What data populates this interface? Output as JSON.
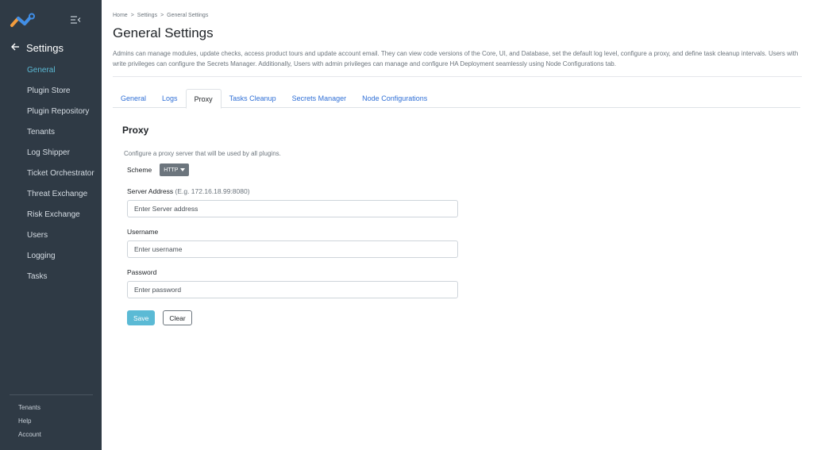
{
  "sidebar": {
    "back_label": "Settings",
    "items": [
      {
        "label": "General",
        "active": true
      },
      {
        "label": "Plugin Store",
        "active": false
      },
      {
        "label": "Plugin Repository",
        "active": false
      },
      {
        "label": "Tenants",
        "active": false
      },
      {
        "label": "Log Shipper",
        "active": false
      },
      {
        "label": "Ticket Orchestrator",
        "active": false
      },
      {
        "label": "Threat Exchange",
        "active": false
      },
      {
        "label": "Risk Exchange",
        "active": false
      },
      {
        "label": "Users",
        "active": false
      },
      {
        "label": "Logging",
        "active": false
      },
      {
        "label": "Tasks",
        "active": false
      }
    ],
    "footer": [
      {
        "label": "Tenants"
      },
      {
        "label": "Help"
      },
      {
        "label": "Account"
      }
    ]
  },
  "breadcrumb": [
    "Home",
    "Settings",
    "General Settings"
  ],
  "breadcrumb_sep": ">",
  "page": {
    "title": "General Settings",
    "description": "Admins can manage modules, update checks, access product tours and update account email. They can view code versions of the Core, UI, and Database, set the default log level, configure a proxy, and define task cleanup intervals. Users with write privileges can configure the Secrets Manager. Additionally, Users with admin privileges can manage and configure HA Deployment seamlessly using Node Configurations tab."
  },
  "tabs": [
    {
      "label": "General",
      "active": false
    },
    {
      "label": "Logs",
      "active": false
    },
    {
      "label": "Proxy",
      "active": true
    },
    {
      "label": "Tasks Cleanup",
      "active": false
    },
    {
      "label": "Secrets Manager",
      "active": false
    },
    {
      "label": "Node Configurations",
      "active": false
    }
  ],
  "proxy": {
    "title": "Proxy",
    "description": "Configure a proxy server that will be used by all plugins.",
    "scheme_label": "Scheme",
    "scheme_value": "HTTP",
    "server_label": "Server Address",
    "server_hint": "(E.g. 172.16.18.99:8080)",
    "server_placeholder": "Enter Server address",
    "username_label": "Username",
    "username_placeholder": "Enter username",
    "password_label": "Password",
    "password_placeholder": "Enter password",
    "save_label": "Save",
    "clear_label": "Clear"
  },
  "colors": {
    "sidebar_bg": "#2f3a45",
    "accent": "#5bbad5",
    "tab_link": "#2f6fd6"
  }
}
